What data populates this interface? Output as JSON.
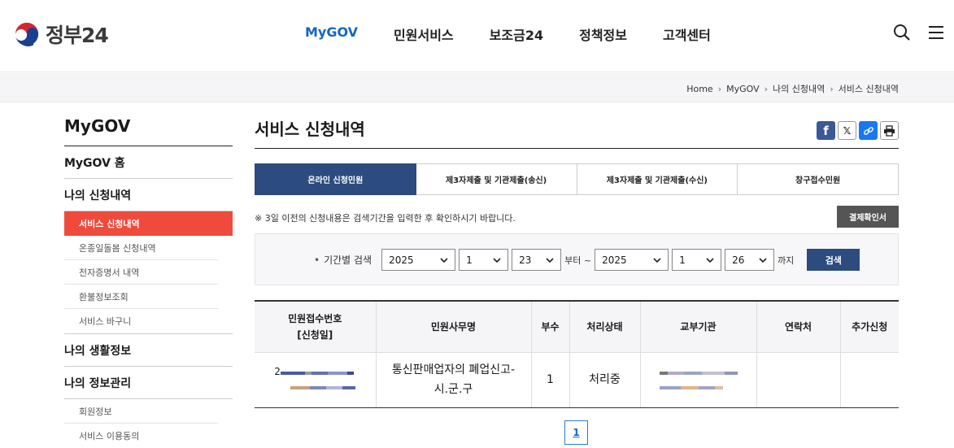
{
  "header": {
    "logo_text": "정부24",
    "nav": [
      "MyGOV",
      "민원서비스",
      "보조금24",
      "정책정보",
      "고객센터"
    ],
    "active_nav": "MyGOV",
    "icons": [
      "search-icon",
      "menu-icon"
    ]
  },
  "breadcrumb": [
    "Home",
    "MyGOV",
    "나의 신청내역",
    "서비스 신청내역"
  ],
  "sidebar": {
    "title": "MyGOV",
    "home": "MyGOV 홈",
    "sections": [
      {
        "label": "나의 신청내역",
        "items": [
          "서비스 신청내역",
          "온종일돌봄 신청내역",
          "전자증명서 내역",
          "환불정보조회",
          "서비스 바구니"
        ],
        "active_index": 0
      },
      {
        "label": "나의 생활정보",
        "items": []
      },
      {
        "label": "나의 정보관리",
        "items": [
          "회원정보",
          "서비스 이용동의"
        ]
      }
    ]
  },
  "main": {
    "title": "서비스 신청내역",
    "share": [
      "facebook-icon",
      "x-icon",
      "link-icon",
      "print-icon"
    ],
    "tabs": [
      "온라인 신청민원",
      "제3자제출 및 기관제출(송신)",
      "제3자제출 및 기관제출(수신)",
      "창구접수민원"
    ],
    "active_tab": 0,
    "notice": "※ 3일 이전의 신청내용은 검색기간을 입력한 후 확인하시기 바랍니다.",
    "cert_button": "결제확인서",
    "search": {
      "label": "기간별 검색",
      "from": {
        "year": "2025",
        "month": "1",
        "day": "23"
      },
      "from_suffix": "부터 ~",
      "to": {
        "year": "2025",
        "month": "1",
        "day": "26"
      },
      "to_suffix": "까지",
      "button": "검색"
    },
    "table": {
      "headers": [
        "민원접수번호\n[신청일]",
        "민원사무명",
        "부수",
        "처리상태",
        "교부기관",
        "연락처",
        "추가신청"
      ],
      "rows": [
        {
          "receipt_prefix": "2",
          "service_name": "통신판매업자의 폐업신고-시.군.구",
          "copies": "1",
          "status": "처리중"
        }
      ]
    },
    "pagination": {
      "current": "1"
    }
  }
}
